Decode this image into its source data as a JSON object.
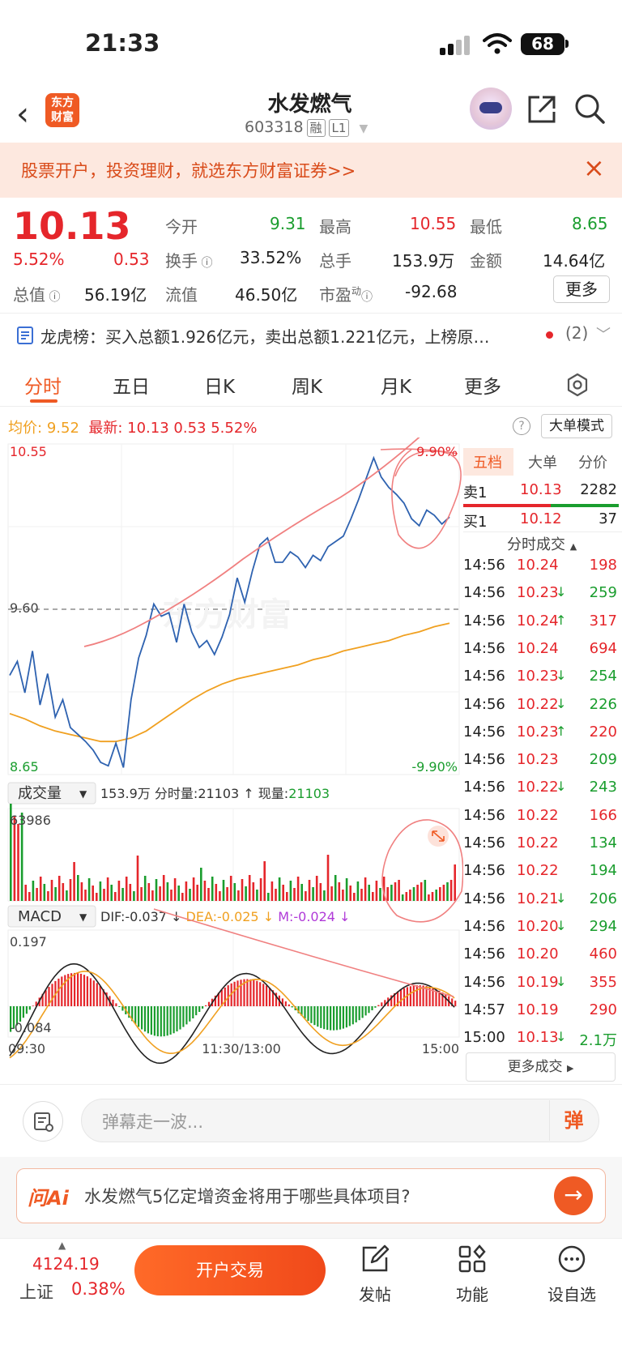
{
  "status": {
    "time": "21:33",
    "battery": "68"
  },
  "nav": {
    "stock_name": "水发燃气",
    "stock_code": "603318",
    "tag_margin": "融",
    "tag_level": "L1",
    "logo_line1": "东方",
    "logo_line2": "财富"
  },
  "banner": {
    "text": "股票开户，投资理财，就选东方财富证券>>"
  },
  "quote": {
    "price": "10.13",
    "change_pct": "5.52%",
    "change": "0.53",
    "labels": {
      "open": "今开",
      "high": "最高",
      "low": "最低",
      "turnover": "换手",
      "volume": "总手",
      "amount": "金额",
      "mktcap": "总值",
      "float": "流值",
      "pe": "市盈",
      "pe_sup": "动"
    },
    "open": "9.31",
    "high": "10.55",
    "low": "8.65",
    "turnover": "33.52%",
    "volume": "153.9万",
    "amount": "14.64亿",
    "mktcap": "56.19亿",
    "float": "46.50亿",
    "pe": "-92.68",
    "more": "更多"
  },
  "lhb": {
    "text": "龙虎榜：买入总额1.926亿元，卖出总额1.221亿元，上榜原…",
    "count": "(2)"
  },
  "tabs": [
    "分时",
    "五日",
    "日K",
    "周K",
    "月K",
    "更多"
  ],
  "chart_info": {
    "avg_label": "均价:",
    "avg": "9.52",
    "latest_label": "最新:",
    "latest": "10.13",
    "chg": "0.53",
    "pct": "5.52%",
    "big_mode": "大单模式"
  },
  "chart_data": {
    "type": "line",
    "price_axis": {
      "max": "10.55",
      "mid": "9.60",
      "min": "8.65",
      "max_pct": "9.90%",
      "min_pct": "-9.90%"
    },
    "x_labels": [
      "09:30",
      "11:30/13:00",
      "15:00"
    ],
    "price_series": [
      9.22,
      9.3,
      9.12,
      9.36,
      9.05,
      9.23,
      8.98,
      9.08,
      8.92,
      8.88,
      8.84,
      8.79,
      8.72,
      8.7,
      8.83,
      8.69,
      9.08,
      9.32,
      9.45,
      9.63,
      9.56,
      9.58,
      9.41,
      9.63,
      9.47,
      9.38,
      9.42,
      9.34,
      9.44,
      9.57,
      9.78,
      9.64,
      9.82,
      9.97,
      10.01,
      9.87,
      9.87,
      9.93,
      9.9,
      9.84,
      9.91,
      9.88,
      9.96,
      9.99,
      10.02,
      10.12,
      10.23,
      10.35,
      10.47,
      10.36,
      10.3,
      10.26,
      10.21,
      10.12,
      10.08,
      10.17,
      10.14,
      10.09,
      10.13
    ],
    "avg_series": [
      9.0,
      8.97,
      8.93,
      8.9,
      8.88,
      8.86,
      8.84,
      8.84,
      8.86,
      8.9,
      8.96,
      9.02,
      9.08,
      9.13,
      9.17,
      9.2,
      9.22,
      9.24,
      9.26,
      9.28,
      9.31,
      9.33,
      9.36,
      9.38,
      9.4,
      9.42,
      9.45,
      9.47,
      9.5,
      9.52
    ],
    "volume": {
      "label": "成交量",
      "total": "153.9万",
      "tick_label": "分时量:",
      "tick": "21103",
      "now_label": "现量:",
      "now": "21103",
      "max": "63986"
    },
    "macd": {
      "label": "MACD",
      "dif_label": "DIF:",
      "dif": "-0.037",
      "dea_label": "DEA:",
      "dea": "-0.025",
      "m_label": "M:",
      "m": "-0.024",
      "max": "0.197",
      "min": "-0.084"
    }
  },
  "orderbook": {
    "tabs": [
      "五档",
      "大单",
      "分价"
    ],
    "sell": {
      "label": "卖1",
      "price": "10.13",
      "vol": "2282"
    },
    "buy": {
      "label": "买1",
      "price": "10.12",
      "vol": "37"
    },
    "trades_title": "分时成交"
  },
  "trades": [
    {
      "t": "14:56",
      "p": "10.24",
      "d": "",
      "v": "198",
      "c": "red"
    },
    {
      "t": "14:56",
      "p": "10.23",
      "d": "↓",
      "v": "259",
      "c": "green"
    },
    {
      "t": "14:56",
      "p": "10.24",
      "d": "↑",
      "v": "317",
      "c": "red"
    },
    {
      "t": "14:56",
      "p": "10.24",
      "d": "",
      "v": "694",
      "c": "red"
    },
    {
      "t": "14:56",
      "p": "10.23",
      "d": "↓",
      "v": "254",
      "c": "green"
    },
    {
      "t": "14:56",
      "p": "10.22",
      "d": "↓",
      "v": "226",
      "c": "green"
    },
    {
      "t": "14:56",
      "p": "10.23",
      "d": "↑",
      "v": "220",
      "c": "red"
    },
    {
      "t": "14:56",
      "p": "10.23",
      "d": "",
      "v": "209",
      "c": "green"
    },
    {
      "t": "14:56",
      "p": "10.22",
      "d": "↓",
      "v": "243",
      "c": "green"
    },
    {
      "t": "14:56",
      "p": "10.22",
      "d": "",
      "v": "166",
      "c": "red"
    },
    {
      "t": "14:56",
      "p": "10.22",
      "d": "",
      "v": "134",
      "c": "green"
    },
    {
      "t": "14:56",
      "p": "10.22",
      "d": "",
      "v": "194",
      "c": "green"
    },
    {
      "t": "14:56",
      "p": "10.21",
      "d": "↓",
      "v": "206",
      "c": "green"
    },
    {
      "t": "14:56",
      "p": "10.20",
      "d": "↓",
      "v": "294",
      "c": "green"
    },
    {
      "t": "14:56",
      "p": "10.20",
      "d": "",
      "v": "460",
      "c": "red"
    },
    {
      "t": "14:56",
      "p": "10.19",
      "d": "↓",
      "v": "355",
      "c": "red"
    },
    {
      "t": "14:57",
      "p": "10.19",
      "d": "",
      "v": "290",
      "c": "red"
    },
    {
      "t": "15:00",
      "p": "10.13",
      "d": "↓",
      "v": "2.1万",
      "c": "green"
    }
  ],
  "more_trades": "更多成交",
  "danmu": {
    "placeholder": "弹幕走一波...",
    "btn": "弹"
  },
  "ai": {
    "logo": "问Ai",
    "question": "水发燃气5亿定增资金将用于哪些具体项目?"
  },
  "bottom": {
    "index_value": "4124.19",
    "index_name": "上证",
    "index_change": "0.38%",
    "open_account": "开户交易",
    "post": "发帖",
    "func": "功能",
    "watch": "设自选"
  },
  "colors": {
    "accent": "#ef5a24",
    "up": "#e5262b",
    "down": "#1a9d2e",
    "price_line": "#2e62b0",
    "avg_line": "#f0a020"
  }
}
